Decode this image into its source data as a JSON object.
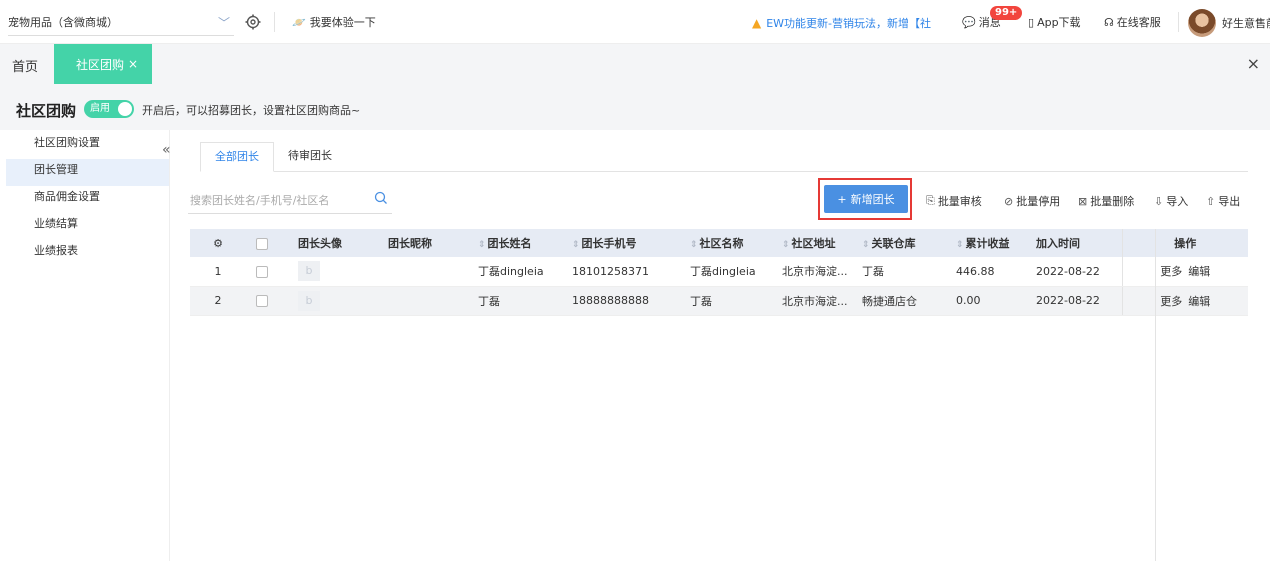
{
  "topbar": {
    "store_name": "宠物用品（含微商城）",
    "try_label": "我要体验一下",
    "notice_text": "EW功能更新-营销玩法，新增【社",
    "messages_label": "消息",
    "messages_badge": "99+",
    "app_label": "App下载",
    "service_label": "在线客服",
    "user_name": "好生意售前"
  },
  "tabs": {
    "home_label": "首页",
    "active_label": "社区团购"
  },
  "page": {
    "title": "社区团购",
    "toggle_label": "启用",
    "hint": "开启后，可以招募团长，设置社区团购商品~"
  },
  "sidebar": {
    "items": [
      {
        "label": "社区团购设置"
      },
      {
        "label": "团长管理"
      },
      {
        "label": "商品佣金设置"
      },
      {
        "label": "业绩结算"
      },
      {
        "label": "业绩报表"
      }
    ]
  },
  "subtabs": {
    "all_label": "全部团长",
    "pending_label": "待审团长"
  },
  "search": {
    "placeholder": "搜索团长姓名/手机号/社区名"
  },
  "toolbar": {
    "add_label": "新增团长",
    "batch_review": "批量审核",
    "batch_disable": "批量停用",
    "batch_delete": "批量删除",
    "import": "导入",
    "export": "导出"
  },
  "table": {
    "headers": [
      "团长头像",
      "团长昵称",
      "团长姓名",
      "团长手机号",
      "社区名称",
      "社区地址",
      "关联仓库",
      "累计收益",
      "加入时间",
      "操作"
    ],
    "rows": [
      {
        "index": "1",
        "name": "丁磊dingleia",
        "phone": "18101258371",
        "community": "丁磊dingleia",
        "address": "北京市海淀...",
        "warehouse": "丁磊",
        "earnings": "446.88",
        "joined": "2022-08-22",
        "more": "更多",
        "edit": "编辑"
      },
      {
        "index": "2",
        "name": "丁磊",
        "phone": "18888888888",
        "community": "丁磊",
        "address": "北京市海淀...",
        "warehouse": "畅捷通店仓",
        "earnings": "0.00",
        "joined": "2022-08-22",
        "more": "更多",
        "edit": "编辑"
      }
    ]
  },
  "colors": {
    "accent_green": "#44d3a8",
    "primary_blue": "#4a90e2",
    "highlight_red": "#e53935"
  }
}
